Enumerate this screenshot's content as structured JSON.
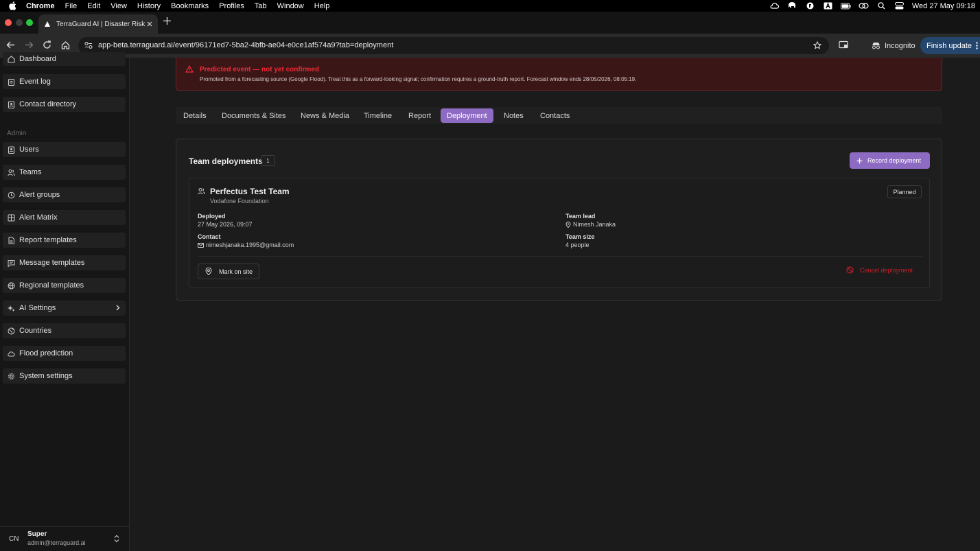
{
  "menubar": {
    "items": [
      {
        "label": "Chrome",
        "bold": true
      },
      {
        "label": "File"
      },
      {
        "label": "Edit"
      },
      {
        "label": "View"
      },
      {
        "label": "History"
      },
      {
        "label": "Bookmarks"
      },
      {
        "label": "Profiles"
      },
      {
        "label": "Tab"
      },
      {
        "label": "Window"
      },
      {
        "label": "Help"
      }
    ],
    "clock": "Wed 27 May  09:18"
  },
  "browser": {
    "tab_title": "TerraGuard AI | Disaster Risk M",
    "url": "app-beta.terraguard.ai/event/96171ed7-5ba2-4bfb-ae04-e0ce1af574a9?tab=deployment",
    "incognito_label": "Incognito",
    "finish_update_label": "Finish update"
  },
  "sidebar": {
    "top_items": [
      {
        "name": "dashboard",
        "label": "Dashboard",
        "icon": "home-icon"
      },
      {
        "name": "event-log",
        "label": "Event log",
        "icon": "clipboard-icon"
      },
      {
        "name": "contact-directory",
        "label": "Contact directory",
        "icon": "contact-book-icon"
      }
    ],
    "admin_label": "Admin",
    "admin_items": [
      {
        "name": "users",
        "label": "Users",
        "icon": "contact-book-icon"
      },
      {
        "name": "teams",
        "label": "Teams",
        "icon": "users-icon"
      },
      {
        "name": "alert-groups",
        "label": "Alert groups",
        "icon": "history-icon"
      },
      {
        "name": "alert-matrix",
        "label": "Alert Matrix",
        "icon": "grid-icon"
      },
      {
        "name": "report-templates",
        "label": "Report templates",
        "icon": "document-icon"
      },
      {
        "name": "message-templates",
        "label": "Message templates",
        "icon": "message-icon"
      },
      {
        "name": "regional-templates",
        "label": "Regional templates",
        "icon": "globe-icon"
      },
      {
        "name": "ai-settings",
        "label": "AI Settings",
        "icon": "sparkles-icon"
      },
      {
        "name": "countries",
        "label": "Countries",
        "icon": "earth-icon"
      },
      {
        "name": "flood-prediction",
        "label": "Flood prediction",
        "icon": "cloud-icon"
      },
      {
        "name": "system-settings",
        "label": "System settings",
        "icon": "gear-icon"
      }
    ],
    "user": {
      "initials": "CN",
      "name": "Super",
      "email": "admin@terraguard.ai"
    }
  },
  "banner": {
    "title": "Predicted event — not yet confirmed",
    "description": "Promoted from a forecasting source (Google Flood). Treat this as a forward-looking signal; confirmation requires a ground-truth report. Forecast window ends 28/05/2026, 08:05:19."
  },
  "tabs": [
    {
      "label": "Details",
      "active": false
    },
    {
      "label": "Documents & Sites",
      "active": false
    },
    {
      "label": "News & Media",
      "active": false
    },
    {
      "label": "Timeline",
      "active": false
    },
    {
      "label": "Report",
      "active": false
    },
    {
      "label": "Deployment",
      "active": true
    },
    {
      "label": "Notes",
      "active": false
    },
    {
      "label": "Contacts",
      "active": false
    }
  ],
  "deployments": {
    "title": "Team deployments",
    "count": "1",
    "record_label": "Record deployment",
    "card": {
      "team_name": "Perfectus Test Team",
      "organization": "Vodafone Foundation",
      "status": "Planned",
      "deployed_label": "Deployed",
      "deployed_value": "27 May 2026, 09:07",
      "team_lead_label": "Team lead",
      "team_lead_value": "Nimesh Janaka",
      "contact_label": "Contact",
      "contact_value": "nimeshjanaka.1995@gmail.com",
      "team_size_label": "Team size",
      "team_size_value": "4 people",
      "mark_on_site_label": "Mark on site",
      "cancel_label": "Cancel deployment"
    }
  },
  "colors": {
    "accent": "#8e6bc3",
    "danger": "#ee2b36",
    "update_button": "#24466d"
  }
}
